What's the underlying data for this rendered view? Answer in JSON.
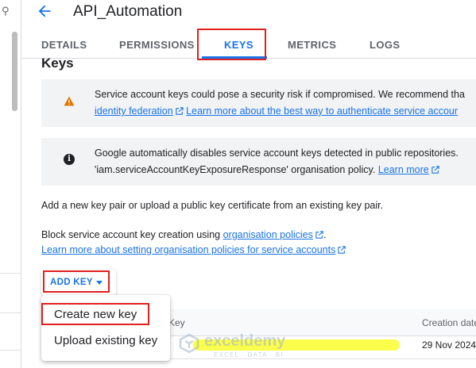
{
  "header": {
    "title": "API_Automation"
  },
  "tabs": [
    {
      "label": "DETAILS"
    },
    {
      "label": "PERMISSIONS"
    },
    {
      "label": "KEYS",
      "active": true
    },
    {
      "label": "METRICS"
    },
    {
      "label": "LOGS"
    }
  ],
  "section": {
    "heading": "Keys"
  },
  "warning_box": {
    "icon": "warning-icon",
    "line1": "Service account keys could pose a security risk if compromised. We recommend tha",
    "link1": "identity federation",
    "link2": "Learn more about the best way to authenticate service accour"
  },
  "info_box": {
    "icon": "info-icon",
    "line1": "Google automatically disables service account keys detected in public repositories.",
    "line2": "'iam.serviceAccountKeyExposureResponse' organisation policy.",
    "link": "Learn more"
  },
  "body": {
    "add_text": "Add a new key pair or upload a public key certificate from an existing key pair.",
    "block_text": "Block service account key creation using",
    "block_link": "organisation policies",
    "block_suffix": ".",
    "learn_link": "Learn more about setting organisation policies for service accounts"
  },
  "add_key_button": {
    "label": "ADD KEY"
  },
  "dropdown": {
    "items": [
      {
        "label": "Create new key"
      },
      {
        "label": "Upload existing key"
      }
    ]
  },
  "table": {
    "columns": [
      {
        "label": "Key"
      },
      {
        "label": "Creation date"
      }
    ],
    "rows": [
      {
        "creation_date": "29 Nov 2024"
      }
    ]
  },
  "watermark": {
    "name": "exceldemy",
    "tagline": "EXCEL · DATA · BI"
  },
  "colors": {
    "accent": "#1a73e8",
    "highlight": "#e02020",
    "warning": "#e37400"
  }
}
